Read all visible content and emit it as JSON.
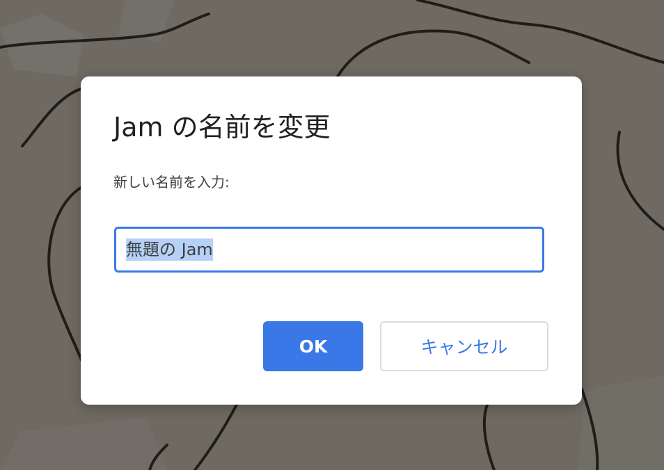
{
  "dialog": {
    "title": "Jam の名前を変更",
    "prompt": "新しい名前を入力:",
    "name_input_value": "無題の Jam",
    "ok_label": "OK",
    "cancel_label": "キャンセル"
  },
  "colors": {
    "accent": "#3b78e7",
    "backdrop": "#6f6a61",
    "selection": "#b6d1f5",
    "title_text": "#202124"
  }
}
